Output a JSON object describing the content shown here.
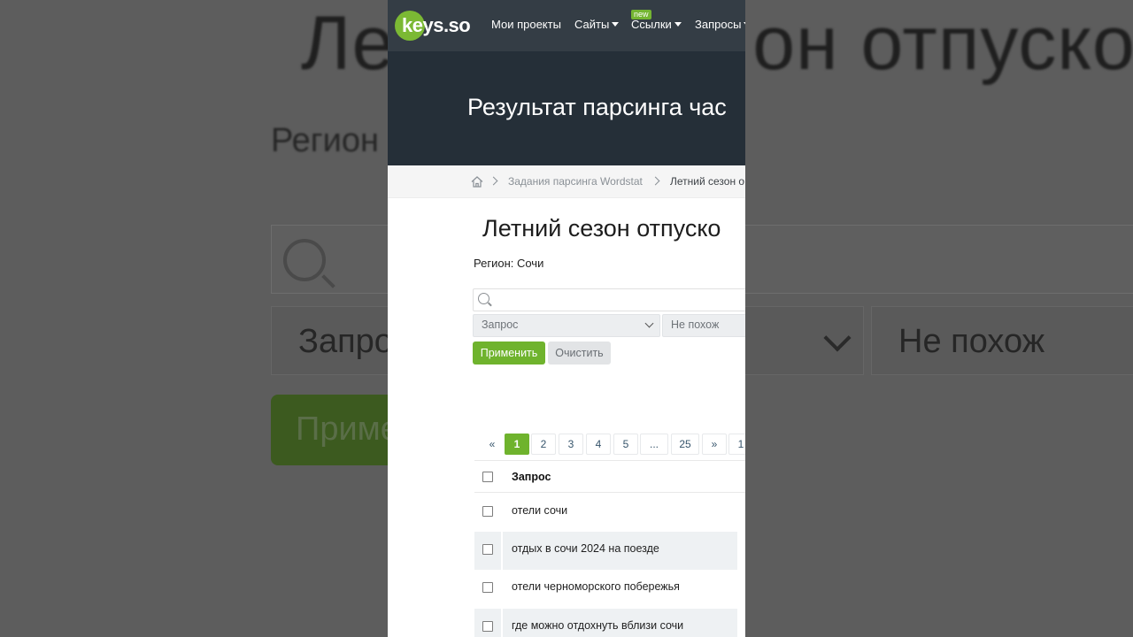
{
  "background": {
    "title_fragment_left": "Ле",
    "title_fragment_right": "он отпуско",
    "region_fragment": "Регион",
    "select_fragment": "Запро",
    "not_like_fragment": "Не похож",
    "apply_fragment": "Приме"
  },
  "navbar": {
    "logo_text": "keys.so",
    "items": [
      {
        "label": "Мои проекты",
        "has_caret": false
      },
      {
        "label": "Сайты",
        "has_caret": true
      },
      {
        "label": "Ссылки",
        "has_caret": true,
        "badge": "new"
      },
      {
        "label": "Запросы",
        "has_caret": true
      }
    ]
  },
  "hero": {
    "title": "Результат парсинга час"
  },
  "breadcrumbs": {
    "home_icon": "home-icon",
    "link": "Задания парсинга Wordstat",
    "current": "Летний сезон о"
  },
  "page": {
    "title": "Летний сезон отпуско",
    "region": "Регион: Сочи"
  },
  "filters": {
    "search_placeholder": "",
    "field_select": "Запрос",
    "condition_select": "Не похож",
    "apply_label": "Применить",
    "clear_label": "Очистить"
  },
  "pagination": {
    "prev": "«",
    "pages": [
      "1",
      "2",
      "3",
      "4",
      "5",
      "...",
      "25"
    ],
    "active": "1",
    "next": "»",
    "last": "1"
  },
  "table": {
    "header": "Запрос",
    "rows": [
      "отели сочи",
      "отдых в сочи 2024 на поезде",
      "отели черноморского побережья",
      "где можно отдохнуть вблизи сочи"
    ]
  },
  "colors": {
    "brand_green": "#6fb32d",
    "navbar": "#343d45",
    "hero": "#252f38"
  }
}
